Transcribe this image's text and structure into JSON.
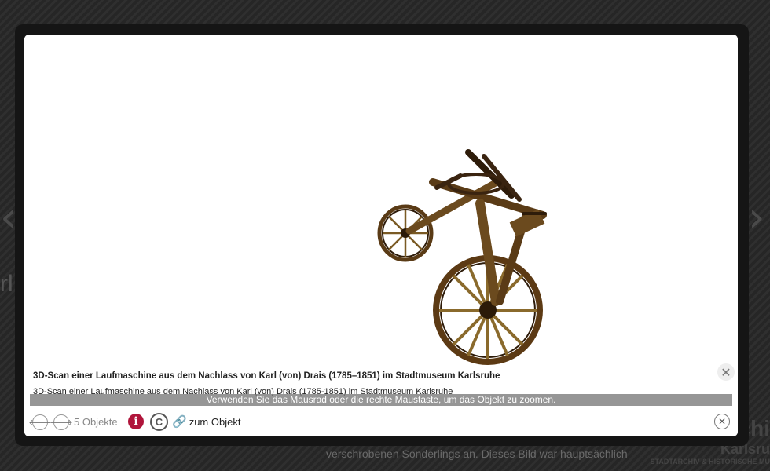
{
  "background": {
    "bottom_text": "verschrobenen Sonderlings an. Dieses Bild war hauptsächlich",
    "logo_line1": "rchi",
    "logo_line2": "Karlsru",
    "logo_line3": "STADTARCHIV & HISTORISCHE MU",
    "left_fragment": "rl"
  },
  "viewer": {
    "object_name": "3D-Scan Laufmaschine",
    "colors": {
      "wood_dark": "#3a2410",
      "wood_mid": "#6b4a1e",
      "wood_light": "#8a6a2c"
    }
  },
  "caption": {
    "title": "3D-Scan einer Laufmaschine aus dem Nachlass von Karl (von) Drais (1785–1851) im Stadtmuseum Karlsruhe",
    "text": "3D-Scan einer Laufmaschine aus dem Nachlass von Karl (von) Drais (1785-1851) im Stadtmuseum Karlsruhe",
    "close_symbol": "✕"
  },
  "hint": "Verwenden Sie das Mausrad oder die rechte Maustaste, um das Objekt zu zoomen.",
  "footer": {
    "prev_symbol": "🡐",
    "next_symbol": "🡒",
    "count": "5 Objekte",
    "info_symbol": "i",
    "copyright_symbol": "C",
    "link_symbol": "🔗",
    "object_link": "zum Objekt",
    "close_symbol": "✕"
  },
  "colors": {
    "accent": "#b0153b",
    "hint_bg": "#7a7a7a"
  }
}
